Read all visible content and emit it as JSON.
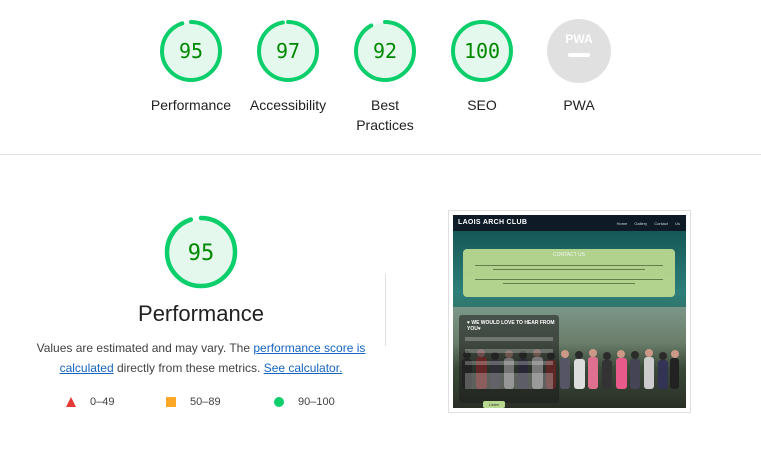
{
  "categories": [
    {
      "label": "Performance",
      "score": "95",
      "fill": 0.95
    },
    {
      "label": "Accessibility",
      "score": "97",
      "fill": 0.97
    },
    {
      "label": "Best\nPractices",
      "score": "92",
      "fill": 0.92
    },
    {
      "label": "SEO",
      "score": "100",
      "fill": 1.0
    },
    {
      "label": "PWA",
      "score": "",
      "fill": 0
    }
  ],
  "pwa_badge": "PWA",
  "detail": {
    "score": "95",
    "fill": 0.95,
    "title": "Performance",
    "desc_part1": "Values are estimated and may vary. The ",
    "desc_link1": "performance score is calculated",
    "desc_part2": " directly from these metrics. ",
    "desc_link2": "See calculator."
  },
  "legend": [
    {
      "range": "0–49"
    },
    {
      "range": "50–89"
    },
    {
      "range": "90–100"
    }
  ],
  "thumbnail": {
    "brand": "LAOIS ARCH CLUB",
    "nav": "Home Gallery Contact Us",
    "card_title": "CONTACT US",
    "form_title": "♥ WE WOULD LOVE TO HEAR FROM YOU♥",
    "button": "Listen"
  },
  "colors": {
    "pass": "#0cce6b",
    "pass_text": "#008800",
    "pass_bg": "#e5f8ed",
    "average": "#ffa726",
    "fail": "#e53935",
    "pwa_gray": "#e0e0e0"
  }
}
